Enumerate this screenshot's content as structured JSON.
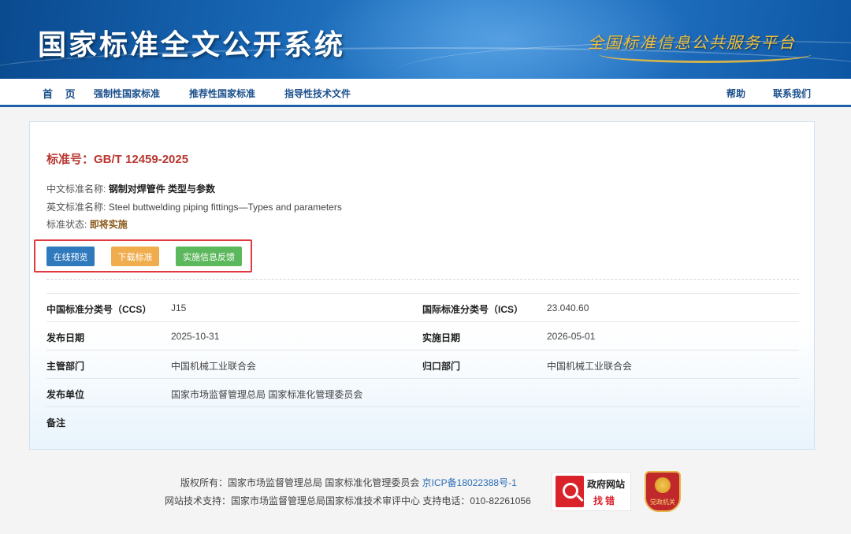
{
  "header": {
    "site_title": "国家标准全文公开系统",
    "slogan": "全国标准信息公共服务平台"
  },
  "nav": {
    "home": "首 页",
    "mandatory": "强制性国家标准",
    "recommended": "推荐性国家标准",
    "guidance": "指导性技术文件",
    "help": "帮助",
    "contact": "联系我们"
  },
  "standard": {
    "number_label": "标准号：",
    "number": "GB/T 12459-2025",
    "cn_name_label": "中文标准名称:",
    "cn_name": "钢制对焊管件 类型与参数",
    "en_name_label": "英文标准名称:",
    "en_name": "Steel buttwelding piping fittings—Types and parameters",
    "status_label": "标准状态:",
    "status": "即将实施"
  },
  "actions": {
    "preview": "在线预览",
    "download": "下载标准",
    "feedback": "实施信息反馈"
  },
  "details": {
    "ccs_label": "中国标准分类号（CCS）",
    "ccs": "J15",
    "ics_label": "国际标准分类号（ICS）",
    "ics": "23.040.60",
    "publish_date_label": "发布日期",
    "publish_date": "2025-10-31",
    "impl_date_label": "实施日期",
    "impl_date": "2026-05-01",
    "authority_label": "主管部门",
    "authority": "中国机械工业联合会",
    "tc_label": "归口部门",
    "tc": "中国机械工业联合会",
    "publisher_label": "发布单位",
    "publisher": "国家市场监督管理总局 国家标准化管理委员会",
    "remark_label": "备注"
  },
  "footer": {
    "copyright": "版权所有：国家市场监督管理总局 国家标准化管理委员会 ",
    "icp": "京ICP备18022388号-1",
    "tech_support": "网站技术支持：国家市场监督管理总局国家标准技术审评中心 支持电话：010-82261056",
    "gov_badge_line1": "政府网站",
    "gov_badge_line2": "找错",
    "party_badge": "党政机关"
  },
  "colors": {
    "nav_text": "#1a4f8b",
    "std_number": "#b8362f",
    "btn_preview": "#2f79bd",
    "btn_download": "#f0ad4e",
    "btn_feedback": "#5cb85c",
    "highlight_box": "#e2383f"
  }
}
